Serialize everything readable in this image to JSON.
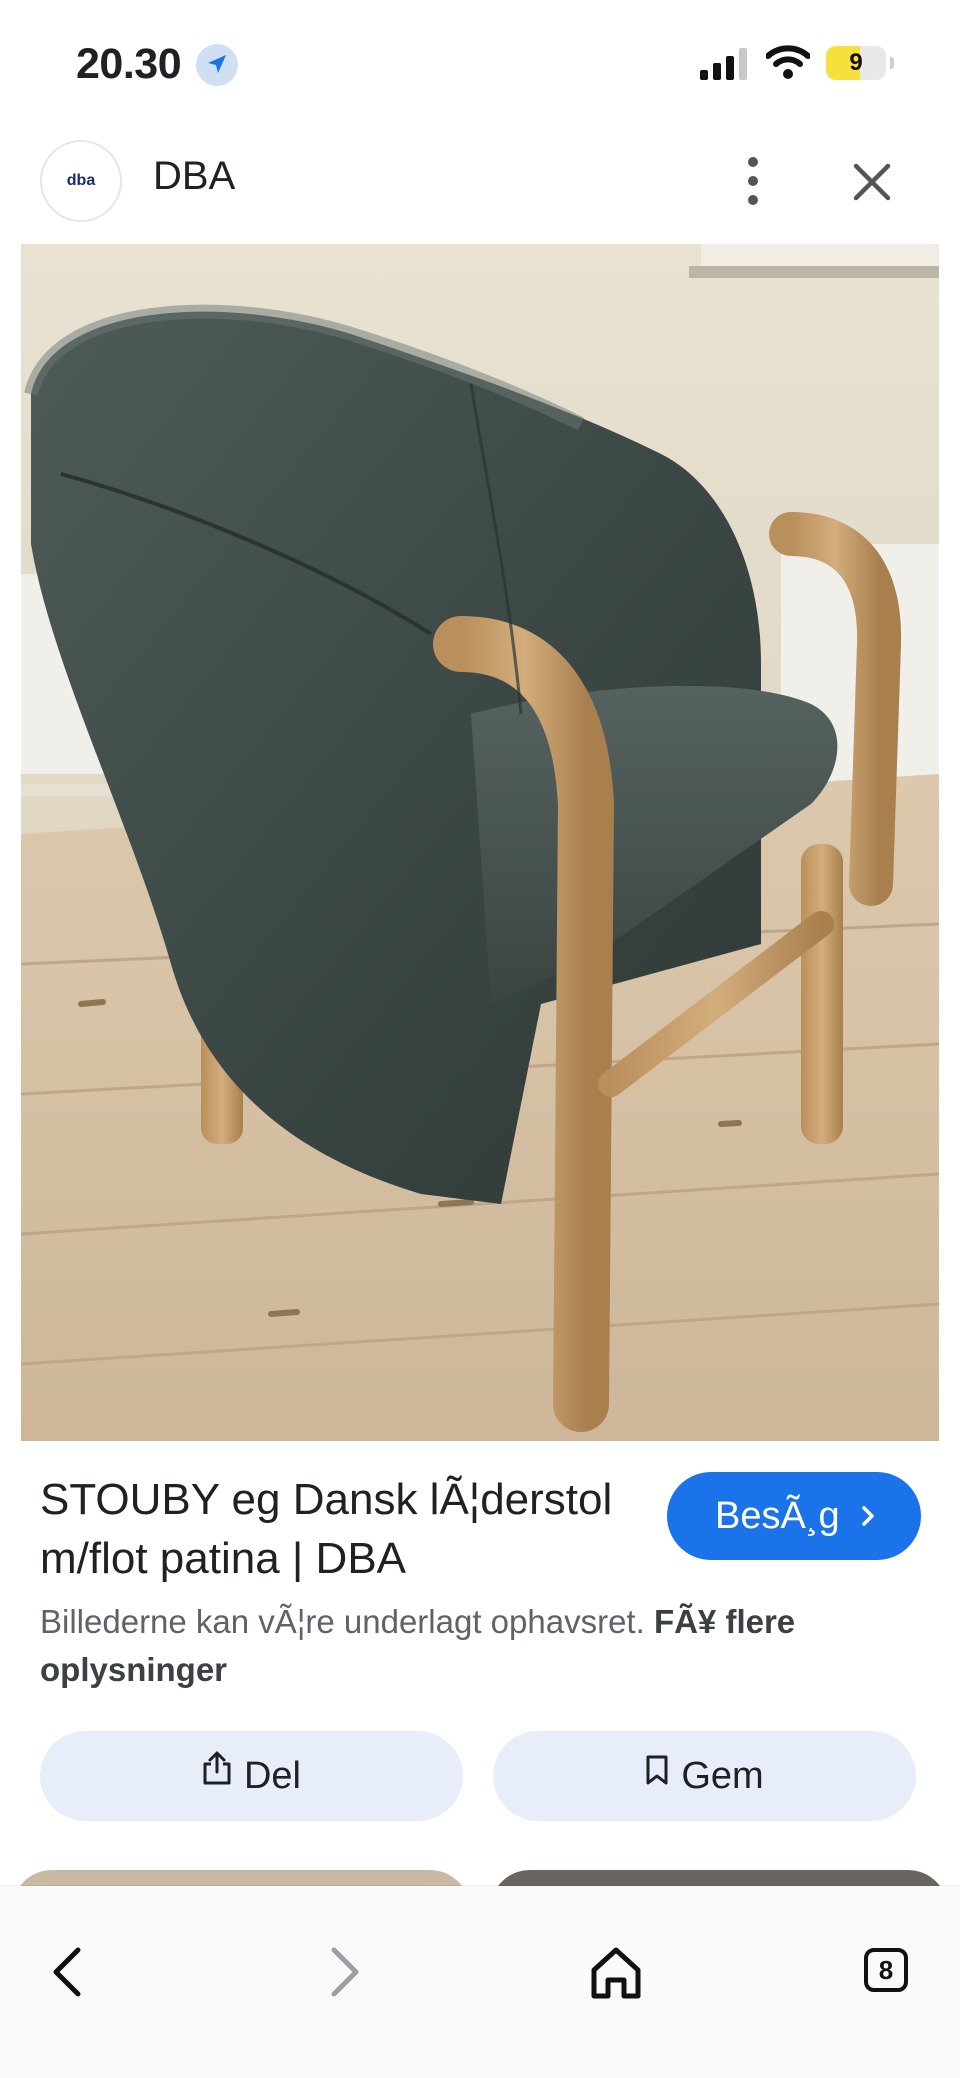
{
  "status_bar": {
    "time": "20.30",
    "battery_level": "9",
    "icons": [
      "location-arrow-icon",
      "cellular-signal-icon",
      "wifi-icon",
      "battery-icon"
    ]
  },
  "header": {
    "logo_text": "dba",
    "site_name": "DBA",
    "icons": [
      "more-vert-icon",
      "close-icon"
    ]
  },
  "result": {
    "title": "STOUBY eg Dansk lÃ¦derstol m/flot patina | DBA",
    "visit_label": "BesÃ¸g",
    "copyright_text": "Billederne kan vÃ¦re underlagt ophavsret.",
    "more_info_label": "FÃ¥ flere oplysninger",
    "share_label": "Del",
    "save_label": "Gem"
  },
  "toolbar": {
    "tabs_count": "8",
    "icons": [
      "back-icon",
      "forward-icon",
      "home-icon",
      "tabs-icon"
    ]
  },
  "colors": {
    "accent": "#1a73e8",
    "pill_bg": "#e8eef9",
    "battery_fill": "#f5e13b",
    "leather": "#3e4a47",
    "oak": "#c9a06c"
  }
}
